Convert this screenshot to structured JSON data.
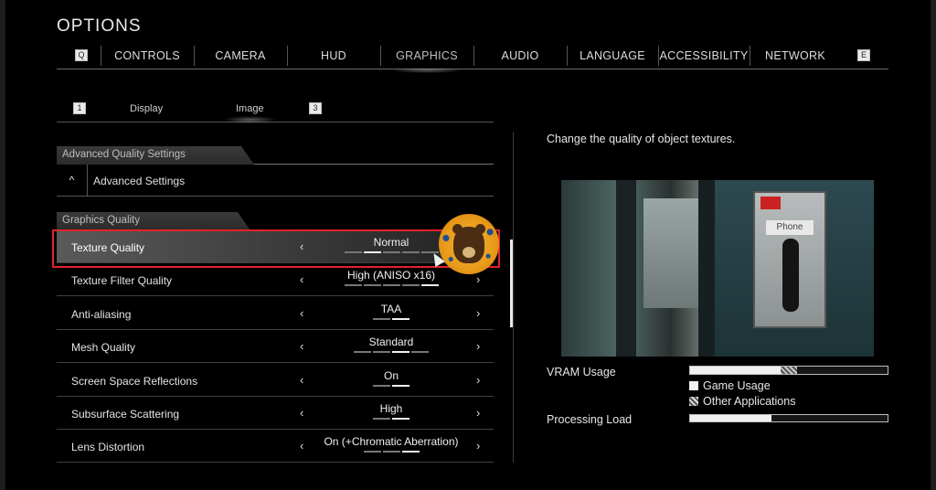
{
  "header": {
    "title": "OPTIONS"
  },
  "tabs": {
    "left_key": "Q",
    "right_key": "E",
    "items": [
      {
        "label": "CONTROLS"
      },
      {
        "label": "CAMERA"
      },
      {
        "label": "HUD"
      },
      {
        "label": "GRAPHICS",
        "active": true
      },
      {
        "label": "AUDIO"
      },
      {
        "label": "LANGUAGE"
      },
      {
        "label": "ACCESSIBILITY"
      },
      {
        "label": "NETWORK"
      }
    ]
  },
  "subtabs": {
    "left_key": "1",
    "right_key": "3",
    "items": [
      {
        "label": "Display"
      },
      {
        "label": "Image",
        "active": true
      }
    ]
  },
  "sections": {
    "advanced_quality": "Advanced Quality Settings",
    "advanced_settings": "Advanced Settings",
    "graphics_quality": "Graphics Quality"
  },
  "settings": [
    {
      "label": "Texture Quality",
      "value": "Normal",
      "level": 2,
      "steps": 5,
      "selected": true
    },
    {
      "label": "Texture Filter Quality",
      "value": "High (ANISO x16)",
      "level": 5,
      "steps": 5
    },
    {
      "label": "Anti-aliasing",
      "value": "TAA",
      "level": 2,
      "steps": 2
    },
    {
      "label": "Mesh Quality",
      "value": "Standard",
      "level": 3,
      "steps": 4
    },
    {
      "label": "Screen Space Reflections",
      "value": "On",
      "level": 2,
      "steps": 2
    },
    {
      "label": "Subsurface Scattering",
      "value": "High",
      "level": 2,
      "steps": 2
    },
    {
      "label": "Lens Distortion",
      "value": "On (+Chromatic Aberration)",
      "level": 3,
      "steps": 3
    }
  ],
  "arrows": {
    "left": "‹",
    "right": "›",
    "collapse": "^"
  },
  "detail": {
    "description": "Change the quality of object textures.",
    "preview_sign": "Phone"
  },
  "usage": {
    "vram_label": "VRAM Usage",
    "game_usage_label": "Game Usage",
    "other_apps_label": "Other Applications",
    "processing_label": "Processing Load",
    "vram_game_fraction": 0.46,
    "vram_other_fraction": 0.08,
    "processing_fraction": 0.41
  },
  "colors": {
    "highlight": "#e0232a",
    "accent": "#f0f0f0"
  }
}
